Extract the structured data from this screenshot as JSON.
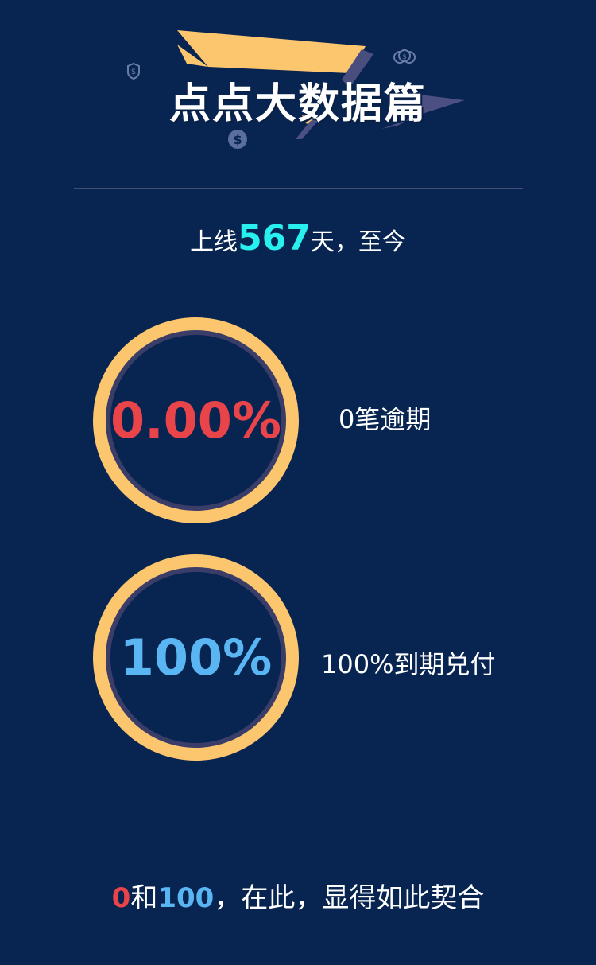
{
  "title": "点点大数据篇",
  "online": {
    "prefix": "上线",
    "days": "567",
    "suffix": "天，至今"
  },
  "stats": [
    {
      "value": "0.00%",
      "caption": "0笔逾期"
    },
    {
      "value": "100%",
      "caption": "100%到期兑付"
    }
  ],
  "footer": {
    "num_a": "0",
    "mid": "和",
    "num_b": "100",
    "rest": "，在此，显得如此契合"
  },
  "colors": {
    "background": "#082451",
    "ring": "#fcc66f",
    "accent_red": "#e84449",
    "accent_blue": "#5ab6f3",
    "accent_cyan": "#28f0ee"
  },
  "icons": [
    "shield-dollar-icon",
    "money-bag-icon",
    "dollar-coin-icon"
  ]
}
